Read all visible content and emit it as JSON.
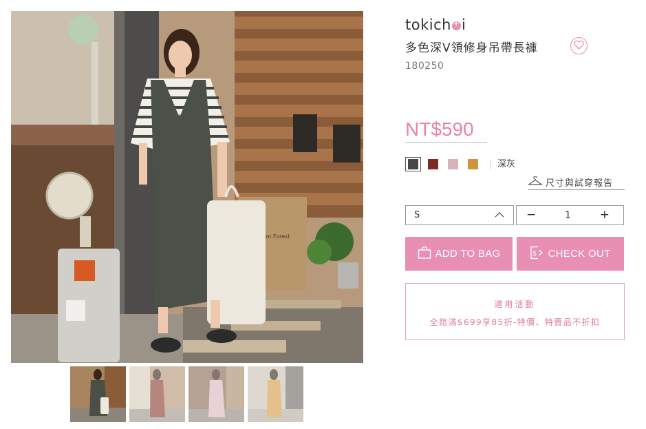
{
  "product": {
    "brand_part1": "tokich",
    "brand_part2": "i",
    "title": "多色深V領修身吊帶長褲",
    "code": "180250",
    "price": "NT$590"
  },
  "colors": {
    "swatches": [
      {
        "name": "dark-gray",
        "hex": "#454a45",
        "selected": true
      },
      {
        "name": "brick-red",
        "hex": "#7d2e22",
        "selected": false
      },
      {
        "name": "pink",
        "hex": "#d9b3ba",
        "selected": false
      },
      {
        "name": "mustard",
        "hex": "#d1943a",
        "selected": false
      }
    ],
    "selected_label": "深灰"
  },
  "size_report": {
    "label": "尺寸與試穿報告",
    "icon": "hanger-icon"
  },
  "size": {
    "selected": "S",
    "icon": "chevron-up-icon"
  },
  "quantity": {
    "value": "1",
    "minus": "−",
    "plus": "+"
  },
  "actions": {
    "add_to_bag": "ADD TO BAG",
    "checkout": "CHECK OUT",
    "bag_icon": "shopping-bag-icon",
    "checkout_icon": "checkout-dollar-icon"
  },
  "promo": {
    "heading": "適用活動",
    "text": "全館滿$699享85折-特價、特賣品不折扣"
  },
  "favorite_icon": "heart-icon",
  "accent": "#e88fb3",
  "thumbnails": [
    {
      "variant": "dark-gray",
      "outfit": "#4a4f48"
    },
    {
      "variant": "brick-red",
      "outfit": "#8a3b2f"
    },
    {
      "variant": "pink",
      "outfit": "#dcb6bd"
    },
    {
      "variant": "mustard",
      "outfit": "#d39a45"
    }
  ]
}
